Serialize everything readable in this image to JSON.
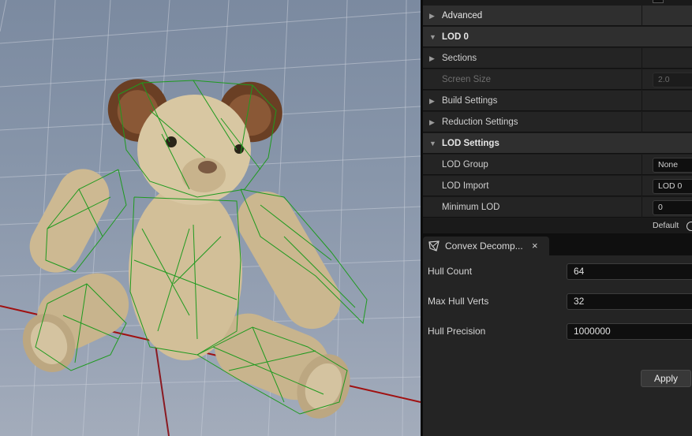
{
  "viewport": {
    "model": "teddy-bear",
    "hull_color": "#1f9a1f",
    "grid_color": "#c9ced8",
    "axis_color": "#a01010"
  },
  "details": {
    "rows": [
      {
        "label": "Advanced",
        "kind": "collapsed"
      },
      {
        "label": "LOD 0",
        "kind": "category-open"
      },
      {
        "label": "Sections",
        "kind": "collapsed"
      },
      {
        "label": "Screen Size",
        "kind": "prop-dim",
        "value": "2.0"
      },
      {
        "label": "Build Settings",
        "kind": "collapsed"
      },
      {
        "label": "Reduction Settings",
        "kind": "collapsed"
      },
      {
        "label": "LOD Settings",
        "kind": "category-open"
      },
      {
        "label": "LOD Group",
        "kind": "prop",
        "value": "None"
      },
      {
        "label": "LOD Import",
        "kind": "prop",
        "value": "LOD 0"
      },
      {
        "label": "Minimum LOD",
        "kind": "prop",
        "value": "0"
      }
    ],
    "default_label": "Default"
  },
  "convex": {
    "tab_label": "Convex Decomp...",
    "tab_close": "×",
    "fields": [
      {
        "label": "Hull Count",
        "value": "64"
      },
      {
        "label": "Max Hull Verts",
        "value": "32"
      },
      {
        "label": "Hull Precision",
        "value": "1000000"
      }
    ],
    "apply_label": "Apply"
  }
}
